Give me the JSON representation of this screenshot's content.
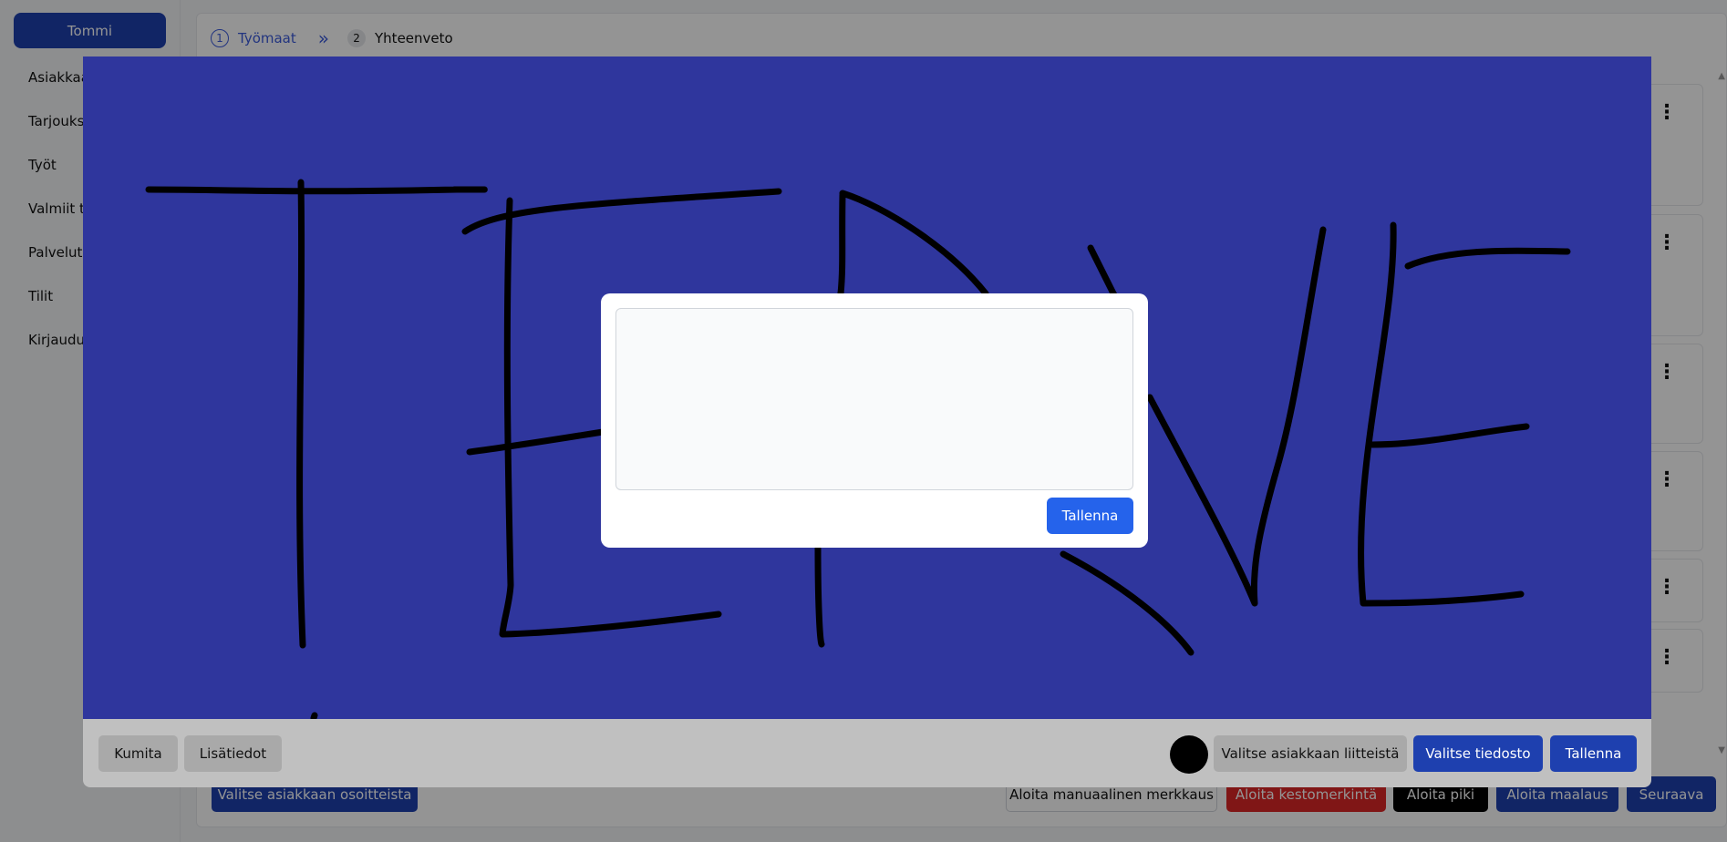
{
  "sidebar": {
    "user_button": "Tommi",
    "items": [
      {
        "label": "Asiakkaat"
      },
      {
        "label": "Tarjoukset"
      },
      {
        "label": "Työt"
      },
      {
        "label": "Valmiit työt"
      },
      {
        "label": "Palvelut"
      },
      {
        "label": "Tilit"
      },
      {
        "label": "Kirjaudu ulos"
      }
    ]
  },
  "steps": [
    {
      "number": "1",
      "label": "Työmaat"
    },
    {
      "number": "2",
      "label": "Yhteenveto"
    }
  ],
  "bottom_bar": {
    "select_address": "Valitse asiakkaan osoitteista",
    "start_manual": "Aloita manuaalinen merkkaus",
    "start_durable": "Aloita kestomerkintä",
    "start_tar": "Aloita piki",
    "start_paint": "Aloita maalaus",
    "next": "Seuraava"
  },
  "drawing": {
    "toolbar": {
      "erase": "Kumita",
      "details": "Lisätiedot",
      "select_attachments": "Valitse asiakkaan liitteistä",
      "select_file": "Valitse tiedosto",
      "save": "Tallenna"
    },
    "pen_color": "#000000",
    "canvas_color": "#2f369d"
  },
  "details_dialog": {
    "textarea_value": "",
    "save": "Tallenna"
  },
  "colors": {
    "primary": "#1e40af",
    "accent": "#2563eb",
    "danger": "#dc2626",
    "black": "#000000"
  }
}
